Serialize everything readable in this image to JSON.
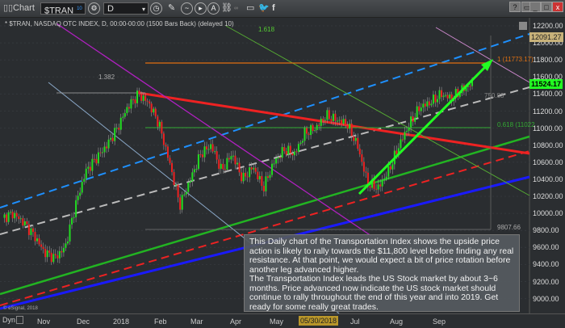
{
  "toolbar": {
    "title": "Chart",
    "symbol": "$TRAN",
    "symbol_badge": "10",
    "interval": "D",
    "win_help": "?",
    "win_close": "x"
  },
  "subtitle": "* $TRAN, NASDAQ OTC INDEX, D, 00:00-00:00 (1500 Bars Back) (delayed 10)",
  "annotations": {
    "fib_1618": "1.618",
    "fib_1382": "1.382",
    "fib_1": "1 (11773.17)",
    "fib_0618": "0.618 (11022",
    "mid": "750.83",
    "low_label": "9807.66",
    "copyright": "© eSignal, 2018"
  },
  "price_axis": {
    "labels": [
      "12200.00",
      "12000.00",
      "11800.00",
      "11600.00",
      "11400.00",
      "11200.00",
      "11000.00",
      "10800.00",
      "10600.00",
      "10400.00",
      "10200.00",
      "10000.00",
      "9800.00",
      "9600.00",
      "9400.00",
      "9200.00",
      "9000.00"
    ],
    "last_price": "11524.17",
    "upper_tag": "12091.27"
  },
  "time_axis": {
    "dyn": "Dyn",
    "labels": [
      "Nov",
      "Dec",
      "2018",
      "Feb",
      "Mar",
      "Apr",
      "May",
      "Jul",
      "Aug",
      "Sep"
    ],
    "cursor_date": "05/30/2018"
  },
  "note": {
    "p1": "This Daily chart of the Transportation Index shows the upside price action is likely to rally towards the $11,800 level before finding any real resistance.  At that point, we would expect a bit of price rotation before another leg advanced higher.",
    "p2": "The Transportation Index leads the US Stock market by about 3~6 months.  Price advanced now indicate the US stock market should continue to rally throughout the end of this year and into 2019.  Get ready for some really great trades."
  },
  "chart_data": {
    "type": "candlestick",
    "series_name": "$TRAN",
    "key_closes": [
      9950,
      10000,
      9900,
      9750,
      9550,
      9480,
      9600,
      10100,
      10500,
      10650,
      10800,
      11000,
      11250,
      11400,
      11300,
      11050,
      10600,
      10100,
      10400,
      10700,
      10800,
      10500,
      10700,
      10400,
      10550,
      10300,
      10600,
      10750,
      10700,
      10950,
      11000,
      11150,
      11100,
      11050,
      10800,
      10350,
      10300,
      10500,
      10800,
      11050,
      11250,
      11300,
      11400,
      11350,
      11450,
      11524.17
    ],
    "ylim": [
      9000,
      12200
    ],
    "colors": {
      "up": "#22dd22",
      "down": "#ee2222"
    }
  }
}
